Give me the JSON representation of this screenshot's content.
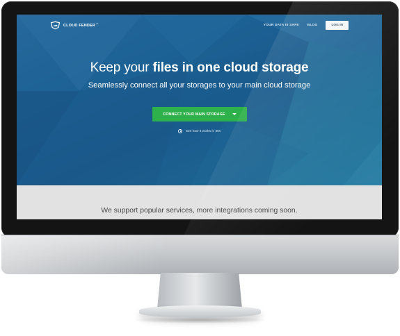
{
  "brand": {
    "name": "CLOUD FENDER",
    "tm": "™"
  },
  "nav": {
    "links": [
      "YOUR DATA IS SAFE",
      "BLOG"
    ],
    "login_label": "LOG IN"
  },
  "hero": {
    "headline_prefix": "Keep your ",
    "headline_bold": "files in one cloud storage",
    "subheadline": "Seamlessly connect all your storages to your main cloud storage",
    "cta_label": "CONNECT YOUR MAIN STORAGE",
    "video_link": "See how it works in 30s"
  },
  "services": {
    "text": "We support popular services, more integrations coming soon."
  },
  "icons": {
    "logo": "shield-cloud-icon",
    "cta": "chevron-down-icon",
    "video": "play-circle-icon"
  },
  "colors": {
    "hero_bg": "#1d6295",
    "cta_bg": "#2eb04a",
    "services_bg": "#e2e2e2",
    "bezel": "#141414"
  }
}
